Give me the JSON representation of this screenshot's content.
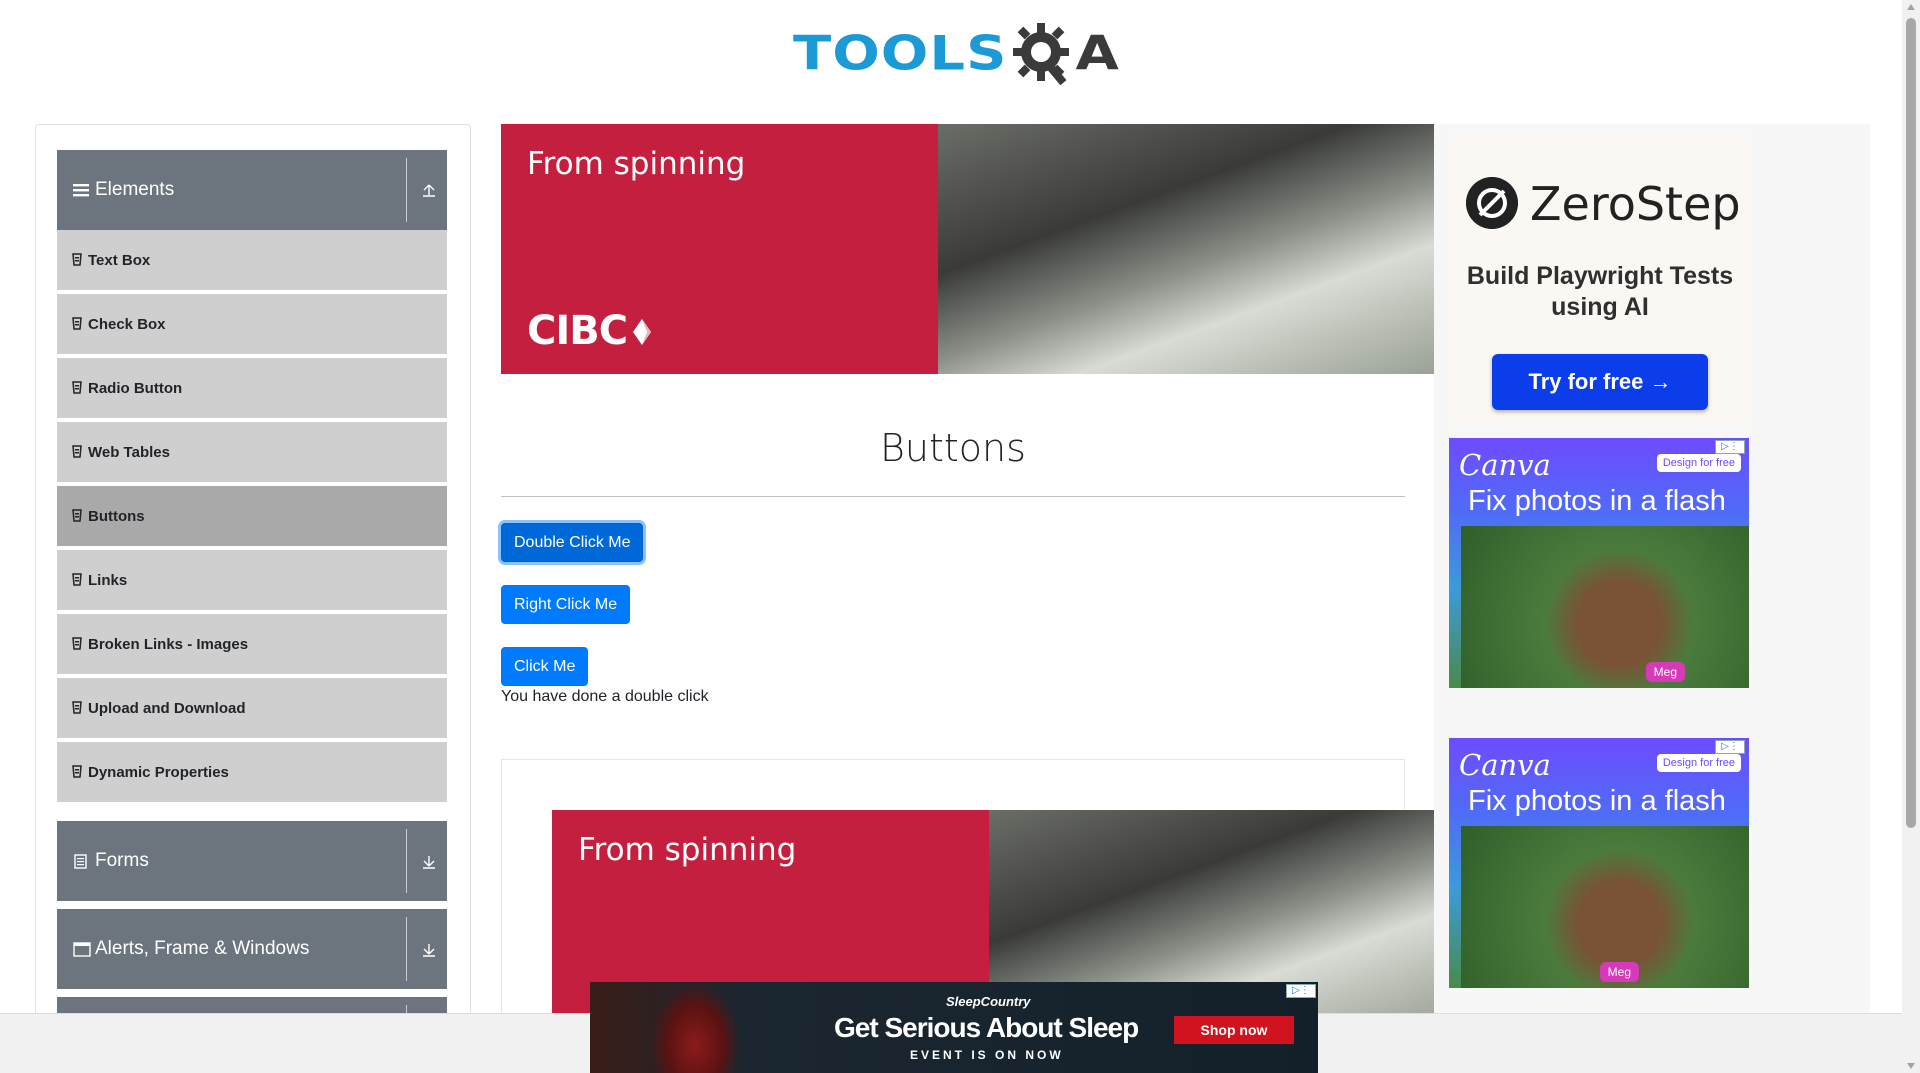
{
  "header": {
    "logo_text_a": "TOOLS",
    "logo_text_b": "A",
    "logo_icon": "gear-q-icon"
  },
  "sidebar": {
    "groups": [
      {
        "label": "Elements",
        "icon": "hamburger-icon",
        "toggle_icon": "collapse-up-icon"
      },
      {
        "label": "Forms",
        "icon": "form-icon",
        "toggle_icon": "expand-down-icon"
      },
      {
        "label": "Alerts, Frame & Windows",
        "icon": "window-icon",
        "toggle_icon": "expand-down-icon"
      }
    ],
    "items": [
      {
        "label": "Text Box"
      },
      {
        "label": "Check Box"
      },
      {
        "label": "Radio Button"
      },
      {
        "label": "Web Tables"
      },
      {
        "label": "Buttons",
        "active": true
      },
      {
        "label": "Links"
      },
      {
        "label": "Broken Links - Images"
      },
      {
        "label": "Upload and Download"
      },
      {
        "label": "Dynamic Properties"
      }
    ]
  },
  "ads": {
    "cibc": {
      "headline": "From spinning",
      "brand": "CIBC"
    },
    "zerostep": {
      "name": "ZeroStep",
      "tagline": "Build Playwright Tests using AI",
      "cta": "Try for free →"
    },
    "canva": {
      "brand": "Canva",
      "free": "Design for free",
      "headline": "Fix photos in a flash",
      "badge": "Meg"
    },
    "sleep": {
      "brand": "SleepCountry",
      "headline": "Get Serious About Sleep",
      "sub": "EVENT IS ON NOW",
      "cta": "Shop now"
    }
  },
  "main": {
    "title": "Buttons",
    "buttons": {
      "double": "Double Click Me",
      "right": "Right Click Me",
      "click": "Click Me"
    },
    "result_text": "You have done a double click"
  },
  "colors": {
    "primary": "#007bff",
    "sidebar_header": "#6c757d",
    "sidebar_item": "#cfcfcf",
    "sidebar_active": "#a9a9a9",
    "cibc_red": "#c41f3e",
    "logo_blue": "#1c9ad6"
  }
}
